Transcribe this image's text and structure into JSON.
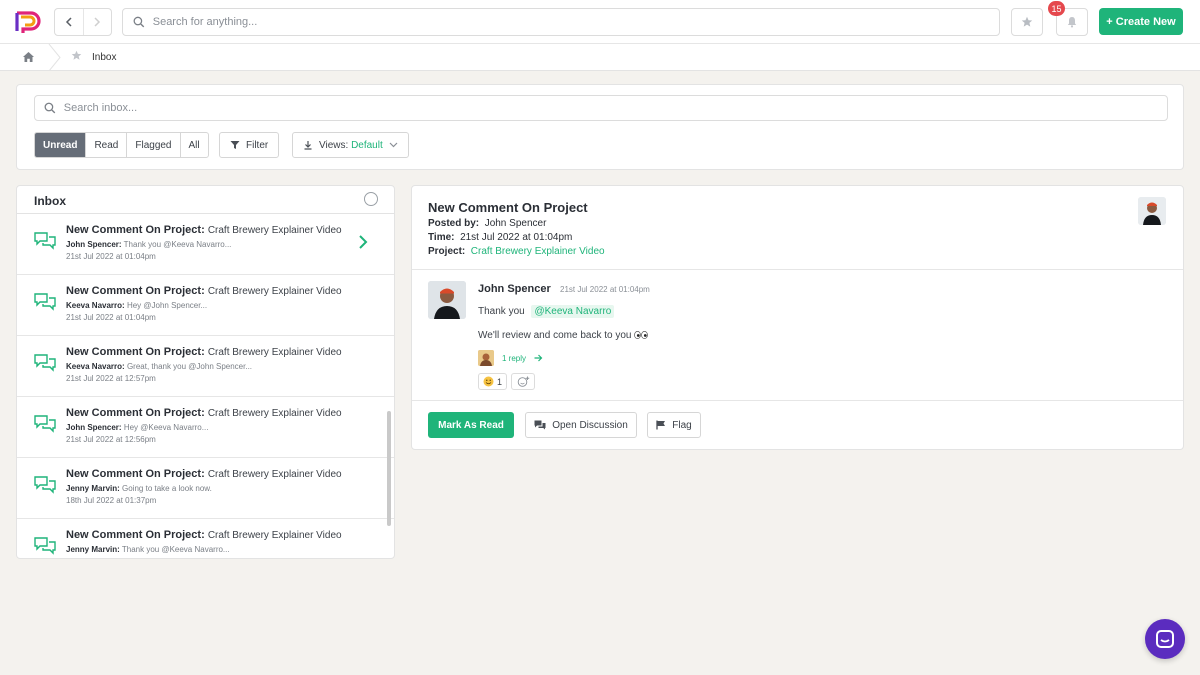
{
  "topbar": {
    "search_placeholder": "Search for anything...",
    "notification_count": "15",
    "create_label": "+ Create New"
  },
  "breadcrumb": {
    "current": "Inbox"
  },
  "filters": {
    "search_placeholder": "Search inbox...",
    "tabs": [
      "Unread",
      "Read",
      "Flagged",
      "All"
    ],
    "filter_label": "Filter",
    "views_label": "Views:",
    "views_value": "Default"
  },
  "inbox": {
    "title": "Inbox",
    "items": [
      {
        "title": "New Comment On Project:",
        "project": "Craft Brewery Explainer Video",
        "author": "John Spencer:",
        "snippet": "Thank you @Keeva Navarro...",
        "time": "21st Jul 2022 at 01:04pm"
      },
      {
        "title": "New Comment On Project:",
        "project": "Craft Brewery Explainer Video",
        "author": "Keeva Navarro:",
        "snippet": "Hey @John Spencer...",
        "time": "21st Jul 2022 at 01:04pm"
      },
      {
        "title": "New Comment On Project:",
        "project": "Craft Brewery Explainer Video",
        "author": "Keeva Navarro:",
        "snippet": "Great, thank you @John Spencer...",
        "time": "21st Jul 2022 at 12:57pm"
      },
      {
        "title": "New Comment On Project:",
        "project": "Craft Brewery Explainer Video",
        "author": "John Spencer:",
        "snippet": "Hey @Keeva Navarro...",
        "time": "21st Jul 2022 at 12:56pm"
      },
      {
        "title": "New Comment On Project:",
        "project": "Craft Brewery Explainer Video",
        "author": "Jenny Marvin:",
        "snippet": "Going to take a look now.",
        "time": "18th Jul 2022 at 01:37pm"
      },
      {
        "title": "New Comment On Project:",
        "project": "Craft Brewery Explainer Video",
        "author": "Jenny Marvin:",
        "snippet": "Thank you @Keeva Navarro...",
        "time": ""
      }
    ]
  },
  "detail": {
    "title": "New Comment On Project",
    "posted_by_label": "Posted by:",
    "posted_by": "John Spencer",
    "time_label": "Time:",
    "time": "21st Jul 2022 at 01:04pm",
    "project_label": "Project:",
    "project": "Craft Brewery Explainer Video",
    "comment": {
      "author": "John Spencer",
      "time": "21st Jul 2022 at 01:04pm",
      "text_prefix": "Thank you",
      "mention": "@Keeva Navarro",
      "text2": "We'll review and come back to you",
      "reply": "1 reply",
      "reaction_count": "1"
    },
    "actions": {
      "mark_read": "Mark As Read",
      "open_discussion": "Open Discussion",
      "flag": "Flag"
    }
  },
  "colors": {
    "accent": "#1fb47a",
    "badge": "#e5484d",
    "chat": "#5b2cbf"
  }
}
